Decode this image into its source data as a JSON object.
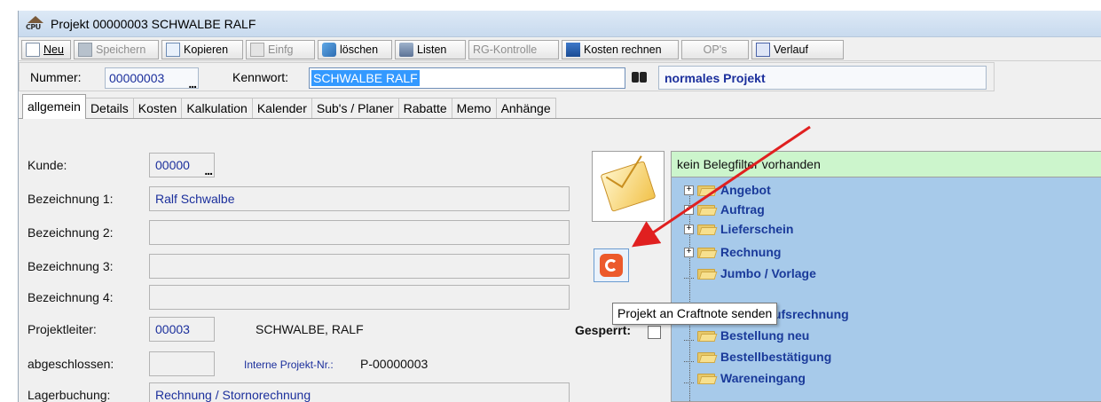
{
  "window": {
    "title": "Projekt 00000003 SCHWALBE RALF",
    "app_icon_label": "CPU"
  },
  "toolbar": {
    "new_label": "Neu",
    "save_label": "Speichern",
    "copy_label": "Kopieren",
    "paste_label": "Einfg",
    "delete_label": "löschen",
    "lists_label": "Listen",
    "rg_label": "RG-Kontrolle",
    "costs_label": "Kosten rechnen",
    "ops_label": "OP's",
    "history_label": "Verlauf"
  },
  "header": {
    "number_label": "Nummer:",
    "number_value": "00000003",
    "keyword_label": "Kennwort:",
    "keyword_value": "SCHWALBE RALF",
    "project_type": "normales Projekt"
  },
  "tabs": [
    {
      "label": "allgemein"
    },
    {
      "label": "Details"
    },
    {
      "label": "Kosten"
    },
    {
      "label": "Kalkulation"
    },
    {
      "label": "Kalender"
    },
    {
      "label": "Sub's / Planer"
    },
    {
      "label": "Rabatte"
    },
    {
      "label": "Memo"
    },
    {
      "label": "Anhänge"
    }
  ],
  "form": {
    "customer_label": "Kunde:",
    "customer_value": "00000",
    "desc1_label": "Bezeichnung 1:",
    "desc1_value": "Ralf Schwalbe",
    "desc2_label": "Bezeichnung 2:",
    "desc2_value": "",
    "desc3_label": "Bezeichnung 3:",
    "desc3_value": "",
    "desc4_label": "Bezeichnung 4:",
    "desc4_value": "",
    "manager_label": "Projektleiter:",
    "manager_code": "00003",
    "manager_name": "SCHWALBE, RALF",
    "closed_label": "abgeschlossen:",
    "closed_value": "",
    "internal_label": "Interne Projekt-Nr.:",
    "internal_value": "P-00000003",
    "stock_label": "Lagerbuchung:",
    "stock_value": "Rechnung / Stornorechnung"
  },
  "side": {
    "tooltip": "Projekt an Craftnote senden",
    "locked_label": "Gesperrt:",
    "filter_text": "kein Belegfilter vorhanden",
    "annotation_arrow_color": "#e02020"
  },
  "tree": [
    {
      "label": "Angebot",
      "expandable": true
    },
    {
      "label": "Auftrag",
      "expandable": true
    },
    {
      "label": "Lieferschein",
      "expandable": true
    },
    {
      "label": "Rechnung",
      "expandable": true
    },
    {
      "label": "Jumbo / Vorlage",
      "expandable": false
    },
    {
      "label": "Barverkaufsrechnung",
      "expandable": false
    },
    {
      "label": "Bestellung neu",
      "expandable": false
    },
    {
      "label": "Bestellbestätigung",
      "expandable": false
    },
    {
      "label": "Wareneingang",
      "expandable": false
    }
  ]
}
